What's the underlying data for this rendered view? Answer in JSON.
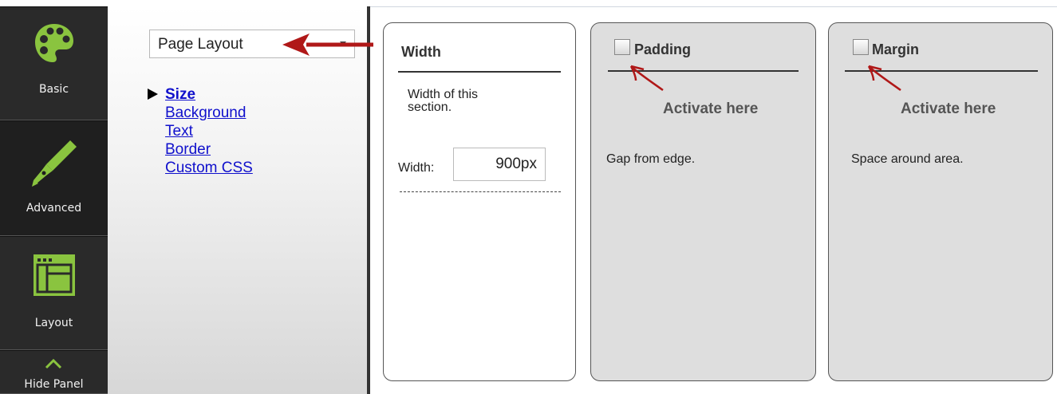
{
  "toolbar": {
    "items": [
      {
        "label": "Basic",
        "icon": "palette-icon"
      },
      {
        "label": "Advanced",
        "icon": "pen-icon",
        "active": true
      },
      {
        "label": "Layout",
        "icon": "layout-icon"
      },
      {
        "label": "Hide Panel",
        "icon": "chevron-up-icon"
      }
    ],
    "icon_color": "#8ac43f"
  },
  "settings": {
    "select_value": "Page Layout",
    "nav": [
      {
        "label": "Size",
        "current": true
      },
      {
        "label": "Background"
      },
      {
        "label": "Text"
      },
      {
        "label": "Border"
      },
      {
        "label": "Custom CSS"
      }
    ]
  },
  "cards": {
    "width": {
      "title": "Width",
      "desc": "Width of this section.",
      "field_label": "Width:",
      "value": "900px"
    },
    "padding": {
      "title": "Padding",
      "checked": false,
      "annotation": "Activate here",
      "desc": "Gap from edge."
    },
    "margin": {
      "title": "Margin",
      "checked": false,
      "annotation": "Activate here",
      "desc": "Space around area."
    }
  },
  "colors": {
    "annotation_red": "#b01818",
    "link_blue": "#1010cc"
  }
}
